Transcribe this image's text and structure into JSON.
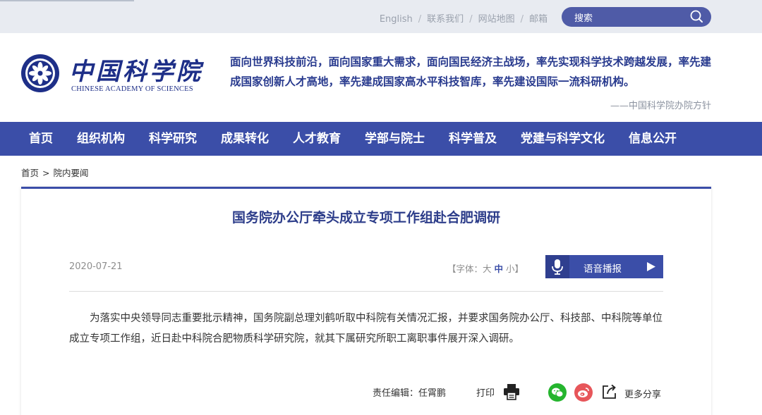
{
  "topbar": {
    "links": [
      "English",
      "联系我们",
      "网站地图",
      "邮箱"
    ],
    "separator": "/",
    "search_label": "搜索"
  },
  "header": {
    "logo_cn": "中国科学院",
    "logo_en": "CHINESE ACADEMY OF SCIENCES",
    "motto": "面向世界科技前沿，面向国家重大需求，面向国民经济主战场，率先实现科学技术跨越发展，率先建成国家创新人才高地，率先建成国家高水平科技智库，率先建设国际一流科研机构。",
    "motto_source": "——中国科学院办院方针"
  },
  "nav": {
    "items": [
      "首页",
      "组织机构",
      "科学研究",
      "成果转化",
      "人才教育",
      "学部与院士",
      "科学普及",
      "党建与科学文化",
      "信息公开"
    ]
  },
  "breadcrumb": {
    "home": "首页",
    "separator": ">",
    "current": "院内要闻"
  },
  "article": {
    "title": "国务院办公厅牵头成立专项工作组赴合肥调研",
    "date": "2020-07-21",
    "font_size": {
      "open": "【字体：",
      "big": "大",
      "mid": "中",
      "small": "小",
      "close": "】"
    },
    "audio_label": "语音播报",
    "body": "为落实中央领导同志重要批示精神，国务院副总理刘鹤听取中科院有关情况汇报，并要求国务院办公厅、科技部、中科院等单位成立专项工作组，近日赴中科院合肥物质科学研究院，就其下属研究所职工离职事件展开深入调研。",
    "editor": "责任编辑：任霄鹏",
    "print_label": "打印",
    "share_more_label": "更多分享"
  },
  "colors": {
    "brand_blue": "#3b4ea8",
    "title_blue": "#2d3d8a",
    "wechat_green": "#25b52e",
    "weibo_red": "#e7565a"
  }
}
